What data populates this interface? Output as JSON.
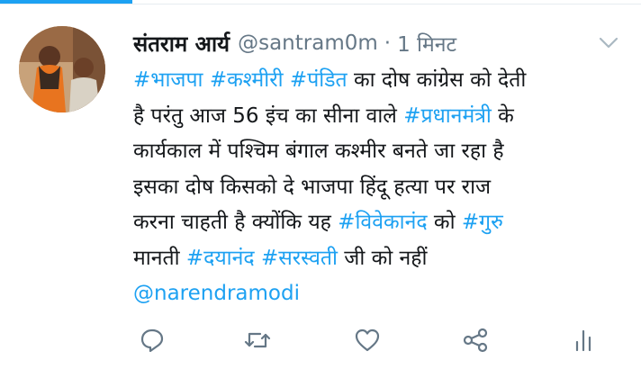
{
  "tweet": {
    "display_name": "संतराम आर्य",
    "handle": "@santram0m",
    "separator": "·",
    "time": "1 मिनट",
    "lines": [
      [
        {
          "t": "#भाजपा",
          "tag": true
        },
        {
          "t": " "
        },
        {
          "t": "#कश्मीरी",
          "tag": true
        },
        {
          "t": " "
        },
        {
          "t": "#पंडित",
          "tag": true
        },
        {
          "t": " का दोष कांग्रेस को देती"
        }
      ],
      [
        {
          "t": "है परंतु आज 56 इंच का सीना वाले "
        },
        {
          "t": "#प्रधानमंत्री",
          "tag": true
        },
        {
          "t": " के"
        }
      ],
      [
        {
          "t": "कार्यकाल में पश्चिम बंगाल कश्मीर बनते जा रहा है"
        }
      ],
      [
        {
          "t": "इसका दोष किसको दे भाजपा हिंदू हत्या पर राज"
        }
      ],
      [
        {
          "t": "करना चाहती है क्योंकि यह "
        },
        {
          "t": "#विवेकानंद",
          "tag": true
        },
        {
          "t": " को "
        },
        {
          "t": "#गुरु",
          "tag": true
        }
      ],
      [
        {
          "t": "मानती "
        },
        {
          "t": "#दयानंद",
          "tag": true
        },
        {
          "t": " "
        },
        {
          "t": "#सरस्वती",
          "tag": true
        },
        {
          "t": " जी को नहीं"
        }
      ],
      [
        {
          "t": "@narendramodi",
          "tag": true
        }
      ]
    ]
  },
  "icons": {
    "caret": "chevron-down-icon",
    "reply": "reply-icon",
    "retweet": "retweet-icon",
    "like": "like-icon",
    "share": "share-icon",
    "analytics": "analytics-icon"
  },
  "colors": {
    "accent": "#1da1f2",
    "text": "#14171a",
    "secondary": "#657786"
  }
}
